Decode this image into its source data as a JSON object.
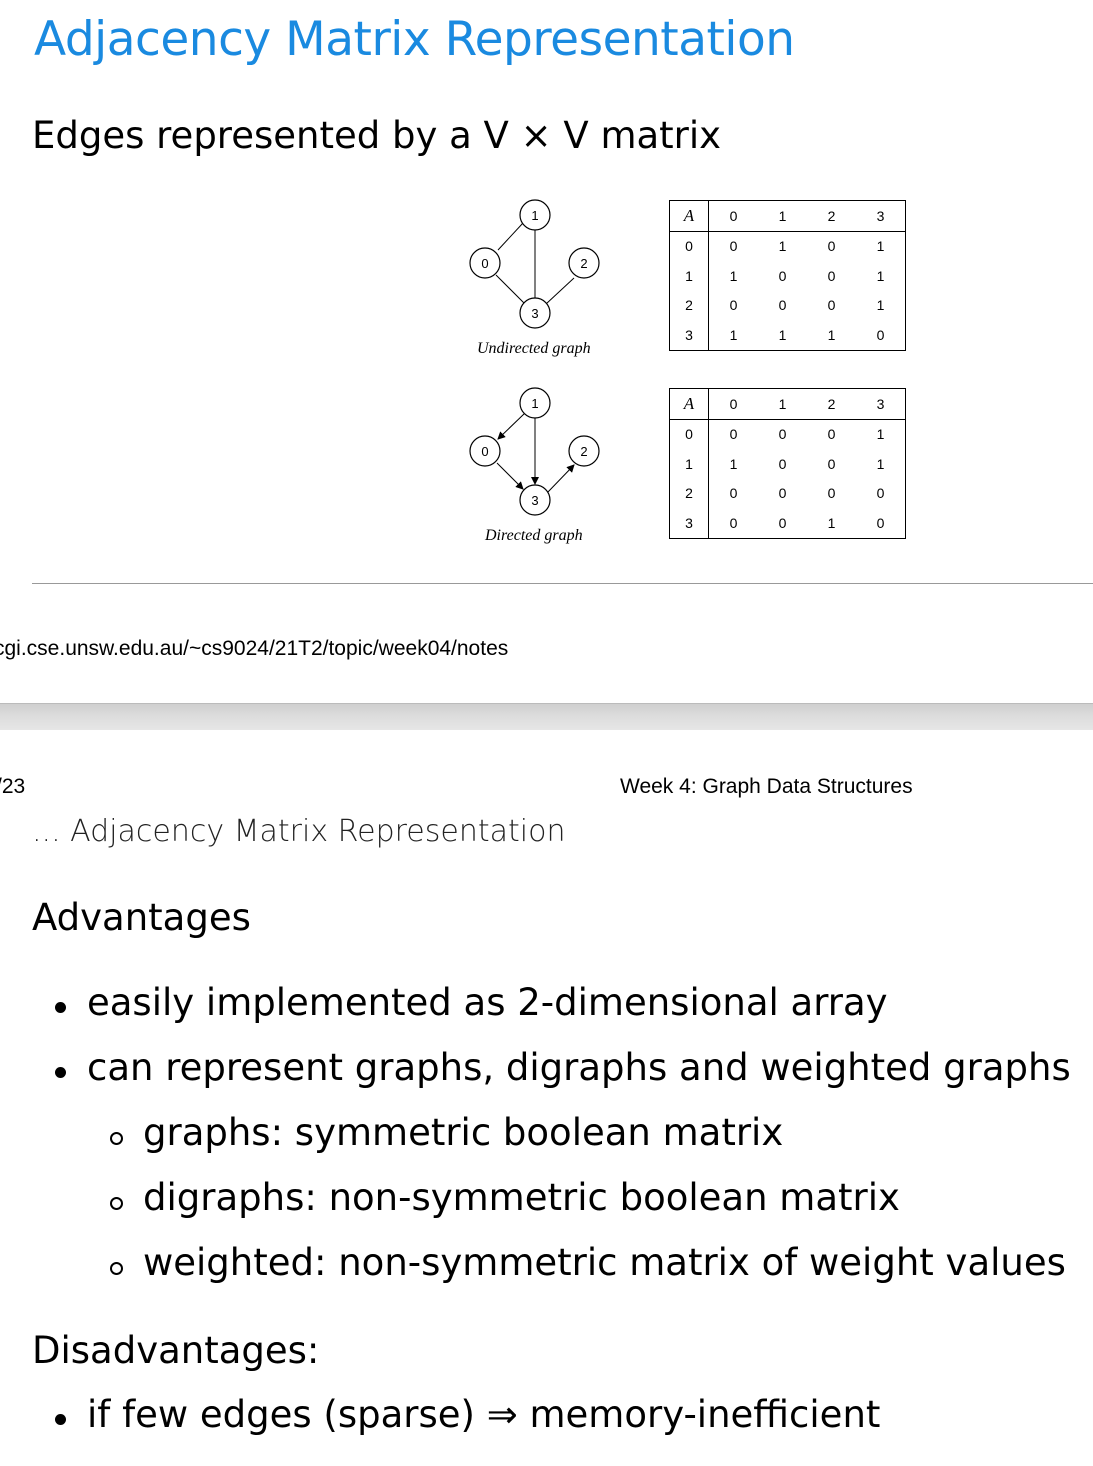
{
  "slide1": {
    "title": "Adjacency Matrix Representation",
    "subtitle": "Edges represented by a V × V matrix",
    "undirected_caption": "Undirected graph",
    "directed_caption": "Directed graph",
    "nodes": [
      "0",
      "1",
      "2",
      "3"
    ],
    "matrix_header": [
      "A",
      "0",
      "1",
      "2",
      "3"
    ],
    "undirected_matrix": [
      [
        "0",
        "0",
        "1",
        "0",
        "1"
      ],
      [
        "1",
        "1",
        "0",
        "0",
        "1"
      ],
      [
        "2",
        "0",
        "0",
        "0",
        "1"
      ],
      [
        "3",
        "1",
        "1",
        "1",
        "0"
      ]
    ],
    "directed_matrix": [
      [
        "0",
        "0",
        "0",
        "0",
        "1"
      ],
      [
        "1",
        "1",
        "0",
        "0",
        "1"
      ],
      [
        "2",
        "0",
        "0",
        "0",
        "0"
      ],
      [
        "3",
        "0",
        "0",
        "1",
        "0"
      ]
    ]
  },
  "footer": {
    "url": "cgi.cse.unsw.edu.au/~cs9024/21T2/topic/week04/notes"
  },
  "slide2": {
    "page_number": "/23",
    "week_label": "Week 4: Graph Data Structures",
    "title": "... Adjacency Matrix Representation",
    "advantages_heading": "Advantages",
    "advantages": [
      "easily implemented as 2-dimensional array",
      "can represent graphs, digraphs and weighted graphs"
    ],
    "advantages_sub": [
      "graphs: symmetric boolean matrix",
      "digraphs: non-symmetric boolean matrix",
      "weighted: non-symmetric matrix of weight values"
    ],
    "disadvantages_heading": "Disadvantages:",
    "disadvantages": [
      "if few edges (sparse) ⇒ memory-inefficient"
    ]
  }
}
